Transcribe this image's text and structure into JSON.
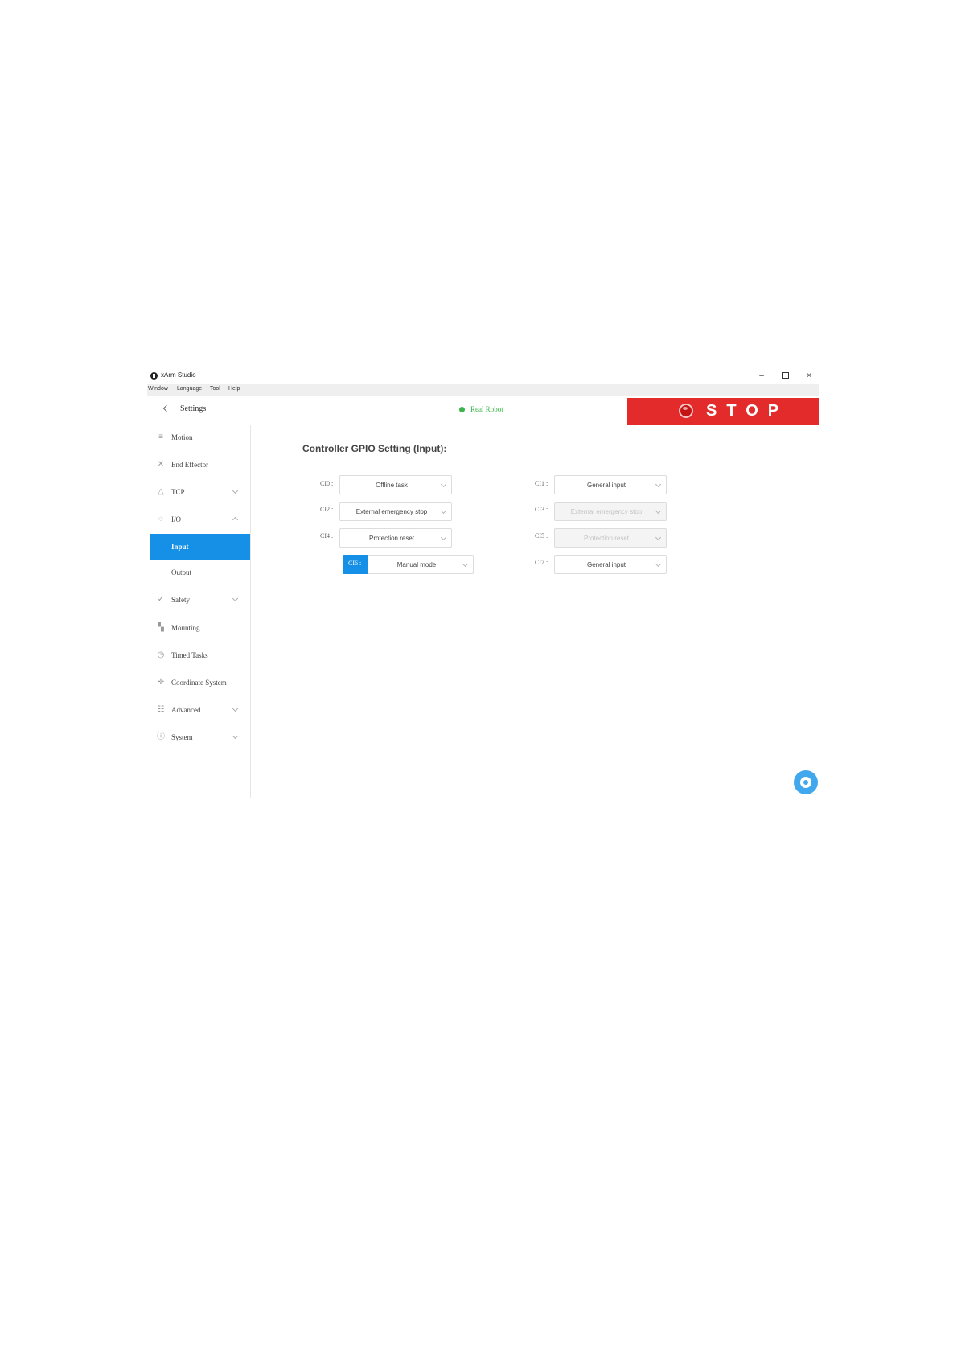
{
  "window": {
    "title": "xArm Studio",
    "controls": {
      "minimize": "–",
      "close": "×"
    }
  },
  "menu": [
    "Window",
    "Language",
    "Tool",
    "Help"
  ],
  "header": {
    "title": "Settings",
    "status": "Real Robot",
    "stop_label": "STOP"
  },
  "sidebar": {
    "items": [
      {
        "label": "Motion"
      },
      {
        "label": "End Effector"
      },
      {
        "label": "TCP"
      },
      {
        "label": "I/O"
      },
      {
        "label": "Input"
      },
      {
        "label": "Output"
      },
      {
        "label": "Safety"
      },
      {
        "label": "Mounting"
      },
      {
        "label": "Timed Tasks"
      },
      {
        "label": "Coordinate System"
      },
      {
        "label": "Advanced"
      },
      {
        "label": "System"
      }
    ]
  },
  "main": {
    "title": "Controller GPIO Setting (Input):",
    "gpio": [
      {
        "label": "CI0 :",
        "value": "Offline task"
      },
      {
        "label": "CI1 :",
        "value": "General input"
      },
      {
        "label": "CI2 :",
        "value": "External emergency stop"
      },
      {
        "label": "CI3 :",
        "value": "External emergency stop"
      },
      {
        "label": "CI4 :",
        "value": "Protection reset"
      },
      {
        "label": "CI5 :",
        "value": "Protection reset"
      },
      {
        "label": "CI6 :",
        "value": "Manual mode"
      },
      {
        "label": "CI7 :",
        "value": "General input"
      }
    ]
  },
  "colors": {
    "accent": "#1590e6",
    "stop": "#e32b2b",
    "status_ok": "#3cb54a"
  }
}
